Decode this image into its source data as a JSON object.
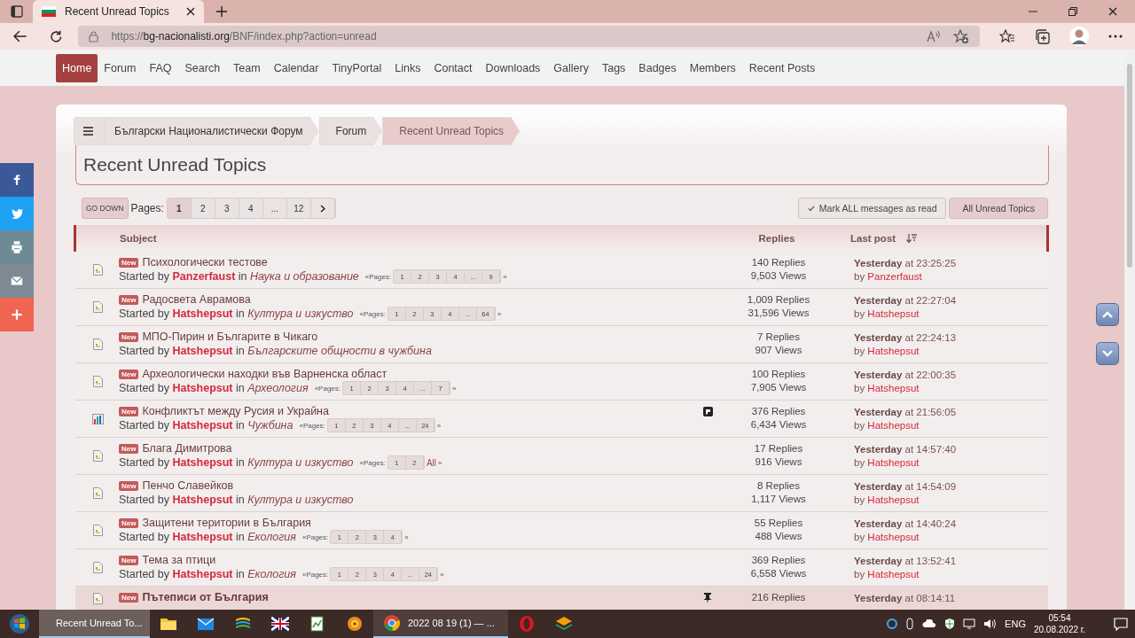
{
  "browser": {
    "tab_title": "Recent Unread Topics",
    "url_host": "bg-nacionalisti.org",
    "url_scheme": "https://",
    "url_path": "/BNF/index.php?action=unread"
  },
  "nav": [
    {
      "label": "Home",
      "selected": true
    },
    {
      "label": "Forum",
      "selected": false
    },
    {
      "label": "FAQ",
      "selected": false
    },
    {
      "label": "Search",
      "selected": false
    },
    {
      "label": "Team",
      "selected": false
    },
    {
      "label": "Calendar",
      "selected": false
    },
    {
      "label": "TinyPortal",
      "selected": false
    },
    {
      "label": "Links",
      "selected": false
    },
    {
      "label": "Contact",
      "selected": false
    },
    {
      "label": "Downloads",
      "selected": false
    },
    {
      "label": "Gallery",
      "selected": false
    },
    {
      "label": "Tags",
      "selected": false
    },
    {
      "label": "Badges",
      "selected": false
    },
    {
      "label": "Members",
      "selected": false
    },
    {
      "label": "Recent Posts",
      "selected": false
    }
  ],
  "breadcrumbs": [
    {
      "label": "Български Националистически Форум",
      "selected": false
    },
    {
      "label": "Forum",
      "selected": false
    },
    {
      "label": "Recent Unread Topics",
      "selected": true
    }
  ],
  "heading": "Recent Unread Topics",
  "go_down": "GO DOWN",
  "pages_label": "Pages:",
  "pages": [
    {
      "label": "1",
      "selected": true
    },
    {
      "label": "2",
      "selected": false
    },
    {
      "label": "3",
      "selected": false
    },
    {
      "label": "4",
      "selected": false
    },
    {
      "label": "...",
      "selected": false
    },
    {
      "label": "12",
      "selected": false
    }
  ],
  "actions": [
    {
      "label": "Mark ALL messages as read",
      "selected": false
    },
    {
      "label": "All Unread Topics",
      "selected": true
    }
  ],
  "columns": {
    "subject": "Subject",
    "replies": "Replies",
    "last_post": "Last post"
  },
  "topics": [
    {
      "kind": "topic",
      "sticky": false,
      "flagged": false,
      "badge": "New",
      "title": "Психологически тестове",
      "started": "Started by",
      "author": "Panzerfaust",
      "in": "in",
      "board": "Наука и образование",
      "pages_open": "«Pages:",
      "pages": [
        "1",
        "2",
        "3",
        "4",
        "...",
        "9"
      ],
      "pages_close": "»",
      "replies": "140 Replies",
      "views": "9,503 Views",
      "time": "**Yesterday** at 23:25:25",
      "by": "by",
      "last_by": "Panzerfaust"
    },
    {
      "kind": "topic",
      "sticky": false,
      "flagged": false,
      "badge": "New",
      "title": "Радосвета Аврамова",
      "started": "Started by",
      "author": "Hatshepsut",
      "in": "in",
      "board": "Култура и изкуство",
      "pages_open": "«Pages:",
      "pages": [
        "1",
        "2",
        "3",
        "4",
        "...",
        "64"
      ],
      "pages_close": "»",
      "replies": "1,009 Replies",
      "views": "31,596 Views",
      "time": "**Yesterday** at 22:27:04",
      "by": "by",
      "last_by": "Hatshepsut"
    },
    {
      "kind": "topic",
      "sticky": false,
      "flagged": false,
      "badge": "New",
      "title": "МПО-Пирин и Българите в Чикаго",
      "started": "Started by",
      "author": "Hatshepsut",
      "in": "in",
      "board": "Българските общности в чужбина",
      "replies": "7 Replies",
      "views": "907 Views",
      "time": "**Yesterday** at 22:24:13",
      "by": "by",
      "last_by": "Hatshepsut"
    },
    {
      "kind": "topic",
      "sticky": false,
      "flagged": false,
      "badge": "New",
      "title": "Археологически находки във Варненска област",
      "started": "Started by",
      "author": "Hatshepsut",
      "in": "in",
      "board": "Археология",
      "pages_open": "«Pages:",
      "pages": [
        "1",
        "2",
        "3",
        "4",
        "...",
        "7"
      ],
      "pages_close": "»",
      "replies": "100 Replies",
      "views": "7,905 Views",
      "time": "**Yesterday** at 22:00:35",
      "by": "by",
      "last_by": "Hatshepsut"
    },
    {
      "kind": "poll",
      "sticky": false,
      "flagged": true,
      "badge": "New",
      "title": "Конфликтът между Русия и Украйна",
      "started": "Started by",
      "author": "Hatshepsut",
      "in": "in",
      "board": "Чужбина",
      "pages_open": "«Pages:",
      "pages": [
        "1",
        "2",
        "3",
        "4",
        "...",
        "24"
      ],
      "pages_close": "»",
      "replies": "376 Replies",
      "views": "6,434 Views",
      "time": "**Yesterday** at 21:56:05",
      "by": "by",
      "last_by": "Hatshepsut"
    },
    {
      "kind": "topic",
      "sticky": false,
      "flagged": false,
      "badge": "New",
      "title": "Блага Димитрова",
      "started": "Started by",
      "author": "Hatshepsut",
      "in": "in",
      "board": "Култура и изкуство",
      "pages_open": "«Pages:",
      "pages": [
        "1",
        "2"
      ],
      "all_link": "All",
      "pages_close": "»",
      "replies": "17 Replies",
      "views": "916 Views",
      "time": "**Yesterday** at 14:57:40",
      "by": "by",
      "last_by": "Hatshepsut"
    },
    {
      "kind": "topic",
      "sticky": false,
      "flagged": false,
      "badge": "New",
      "title": "Пенчо Славейков",
      "started": "Started by",
      "author": "Hatshepsut",
      "in": "in",
      "board": "Култура и изкуство",
      "replies": "8 Replies",
      "views": "1,117 Views",
      "time": "**Yesterday** at 14:54:09",
      "by": "by",
      "last_by": "Hatshepsut"
    },
    {
      "kind": "topic",
      "sticky": false,
      "flagged": false,
      "badge": "New",
      "title": "Защитени територии в България",
      "started": "Started by",
      "author": "Hatshepsut",
      "in": "in",
      "board": "Екология",
      "pages_open": "«Pages:",
      "pages": [
        "1",
        "2",
        "3",
        "4"
      ],
      "pages_close": "»",
      "replies": "55 Replies",
      "views": "488 Views",
      "time": "**Yesterday** at 14:40:24",
      "by": "by",
      "last_by": "Hatshepsut"
    },
    {
      "kind": "topic",
      "sticky": false,
      "flagged": false,
      "badge": "New",
      "title": "Тема за птици",
      "started": "Started by",
      "author": "Hatshepsut",
      "in": "in",
      "board": "Екология",
      "pages_open": "«Pages:",
      "pages": [
        "1",
        "2",
        "3",
        "4",
        "...",
        "24"
      ],
      "pages_close": "»",
      "replies": "369 Replies",
      "views": "6,558 Views",
      "time": "**Yesterday** at 13:52:41",
      "by": "by",
      "last_by": "Hatshepsut"
    },
    {
      "kind": "topic",
      "sticky": true,
      "flagged": false,
      "badge": "New",
      "title": "Пътеписи от България",
      "replies": "216 Replies",
      "time": "**Yesterday** at 08:14:11"
    }
  ],
  "social": [
    {
      "kind": "facebook",
      "color": "#3b5998"
    },
    {
      "kind": "twitter",
      "color": "#1da1f2"
    },
    {
      "kind": "print",
      "color": "#6d8a94"
    },
    {
      "kind": "email",
      "color": "#7d8a94"
    },
    {
      "kind": "more",
      "color": "#f0654f"
    }
  ],
  "taskbar": {
    "apps": [
      {
        "kind": "edge",
        "selected": true,
        "running": true,
        "label": "Recent Unread To..."
      },
      {
        "kind": "folder",
        "selected": false,
        "running": false
      },
      {
        "kind": "mail",
        "selected": false,
        "running": false
      },
      {
        "kind": "stack",
        "selected": false,
        "running": false
      },
      {
        "kind": "ukflag",
        "selected": false,
        "running": false
      },
      {
        "kind": "notepad",
        "selected": false,
        "running": false
      },
      {
        "kind": "xnview",
        "selected": false,
        "running": false
      },
      {
        "kind": "chrome",
        "selected": false,
        "running": true,
        "label": "2022 08 19 (1) — ..."
      },
      {
        "kind": "opera",
        "selected": false,
        "running": false
      },
      {
        "kind": "layers",
        "selected": false,
        "running": false
      }
    ],
    "language": "ENG",
    "time": "05:54",
    "date": "20.08.2022 г."
  }
}
